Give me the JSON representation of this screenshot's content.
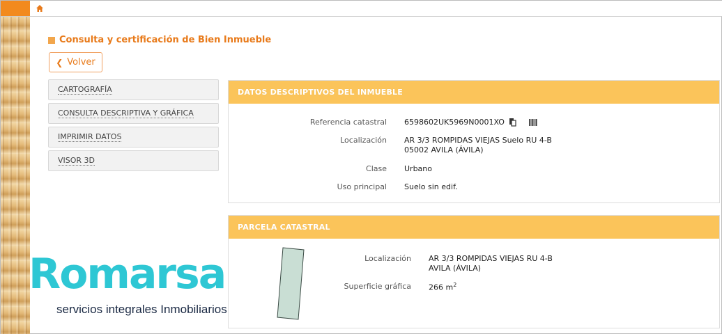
{
  "nav": {
    "home_icon": "home-icon"
  },
  "page": {
    "title": "Consulta y certificación de Bien Inmueble",
    "back_label": "Volver"
  },
  "menu": {
    "items": [
      {
        "label": "CARTOGRAFÍA"
      },
      {
        "label": "CONSULTA DESCRIPTIVA Y GRÁFICA"
      },
      {
        "label": "IMPRIMIR DATOS"
      },
      {
        "label": "VISOR 3D"
      }
    ]
  },
  "descriptivos": {
    "title": "DATOS DESCRIPTIVOS DEL INMUEBLE",
    "referencia_label": "Referencia catastral",
    "referencia_value": "6598602UK5969N0001XO",
    "localizacion_label": "Localización",
    "localizacion_line1": "AR 3/3 ROMPIDAS VIEJAS Suelo RU 4-B",
    "localizacion_line2": "05002 AVILA (ÁVILA)",
    "clase_label": "Clase",
    "clase_value": "Urbano",
    "uso_label": "Uso principal",
    "uso_value": "Suelo sin edif."
  },
  "parcela": {
    "title": "PARCELA CATASTRAL",
    "localizacion_label": "Localización",
    "localizacion_line1": "AR 3/3 ROMPIDAS VIEJAS RU 4-B",
    "localizacion_line2": "AVILA (ÁVILA)",
    "superficie_label": "Superficie gráfica",
    "superficie_value": "266 m",
    "superficie_unit_sup": "2"
  },
  "watermark": {
    "brand": "Romarsa",
    "tagline": "servicios integrales Inmobiliarios"
  },
  "colors": {
    "accent": "#e87a1a",
    "panel_header": "#fbc45a",
    "logo": "#2ec7d4"
  }
}
